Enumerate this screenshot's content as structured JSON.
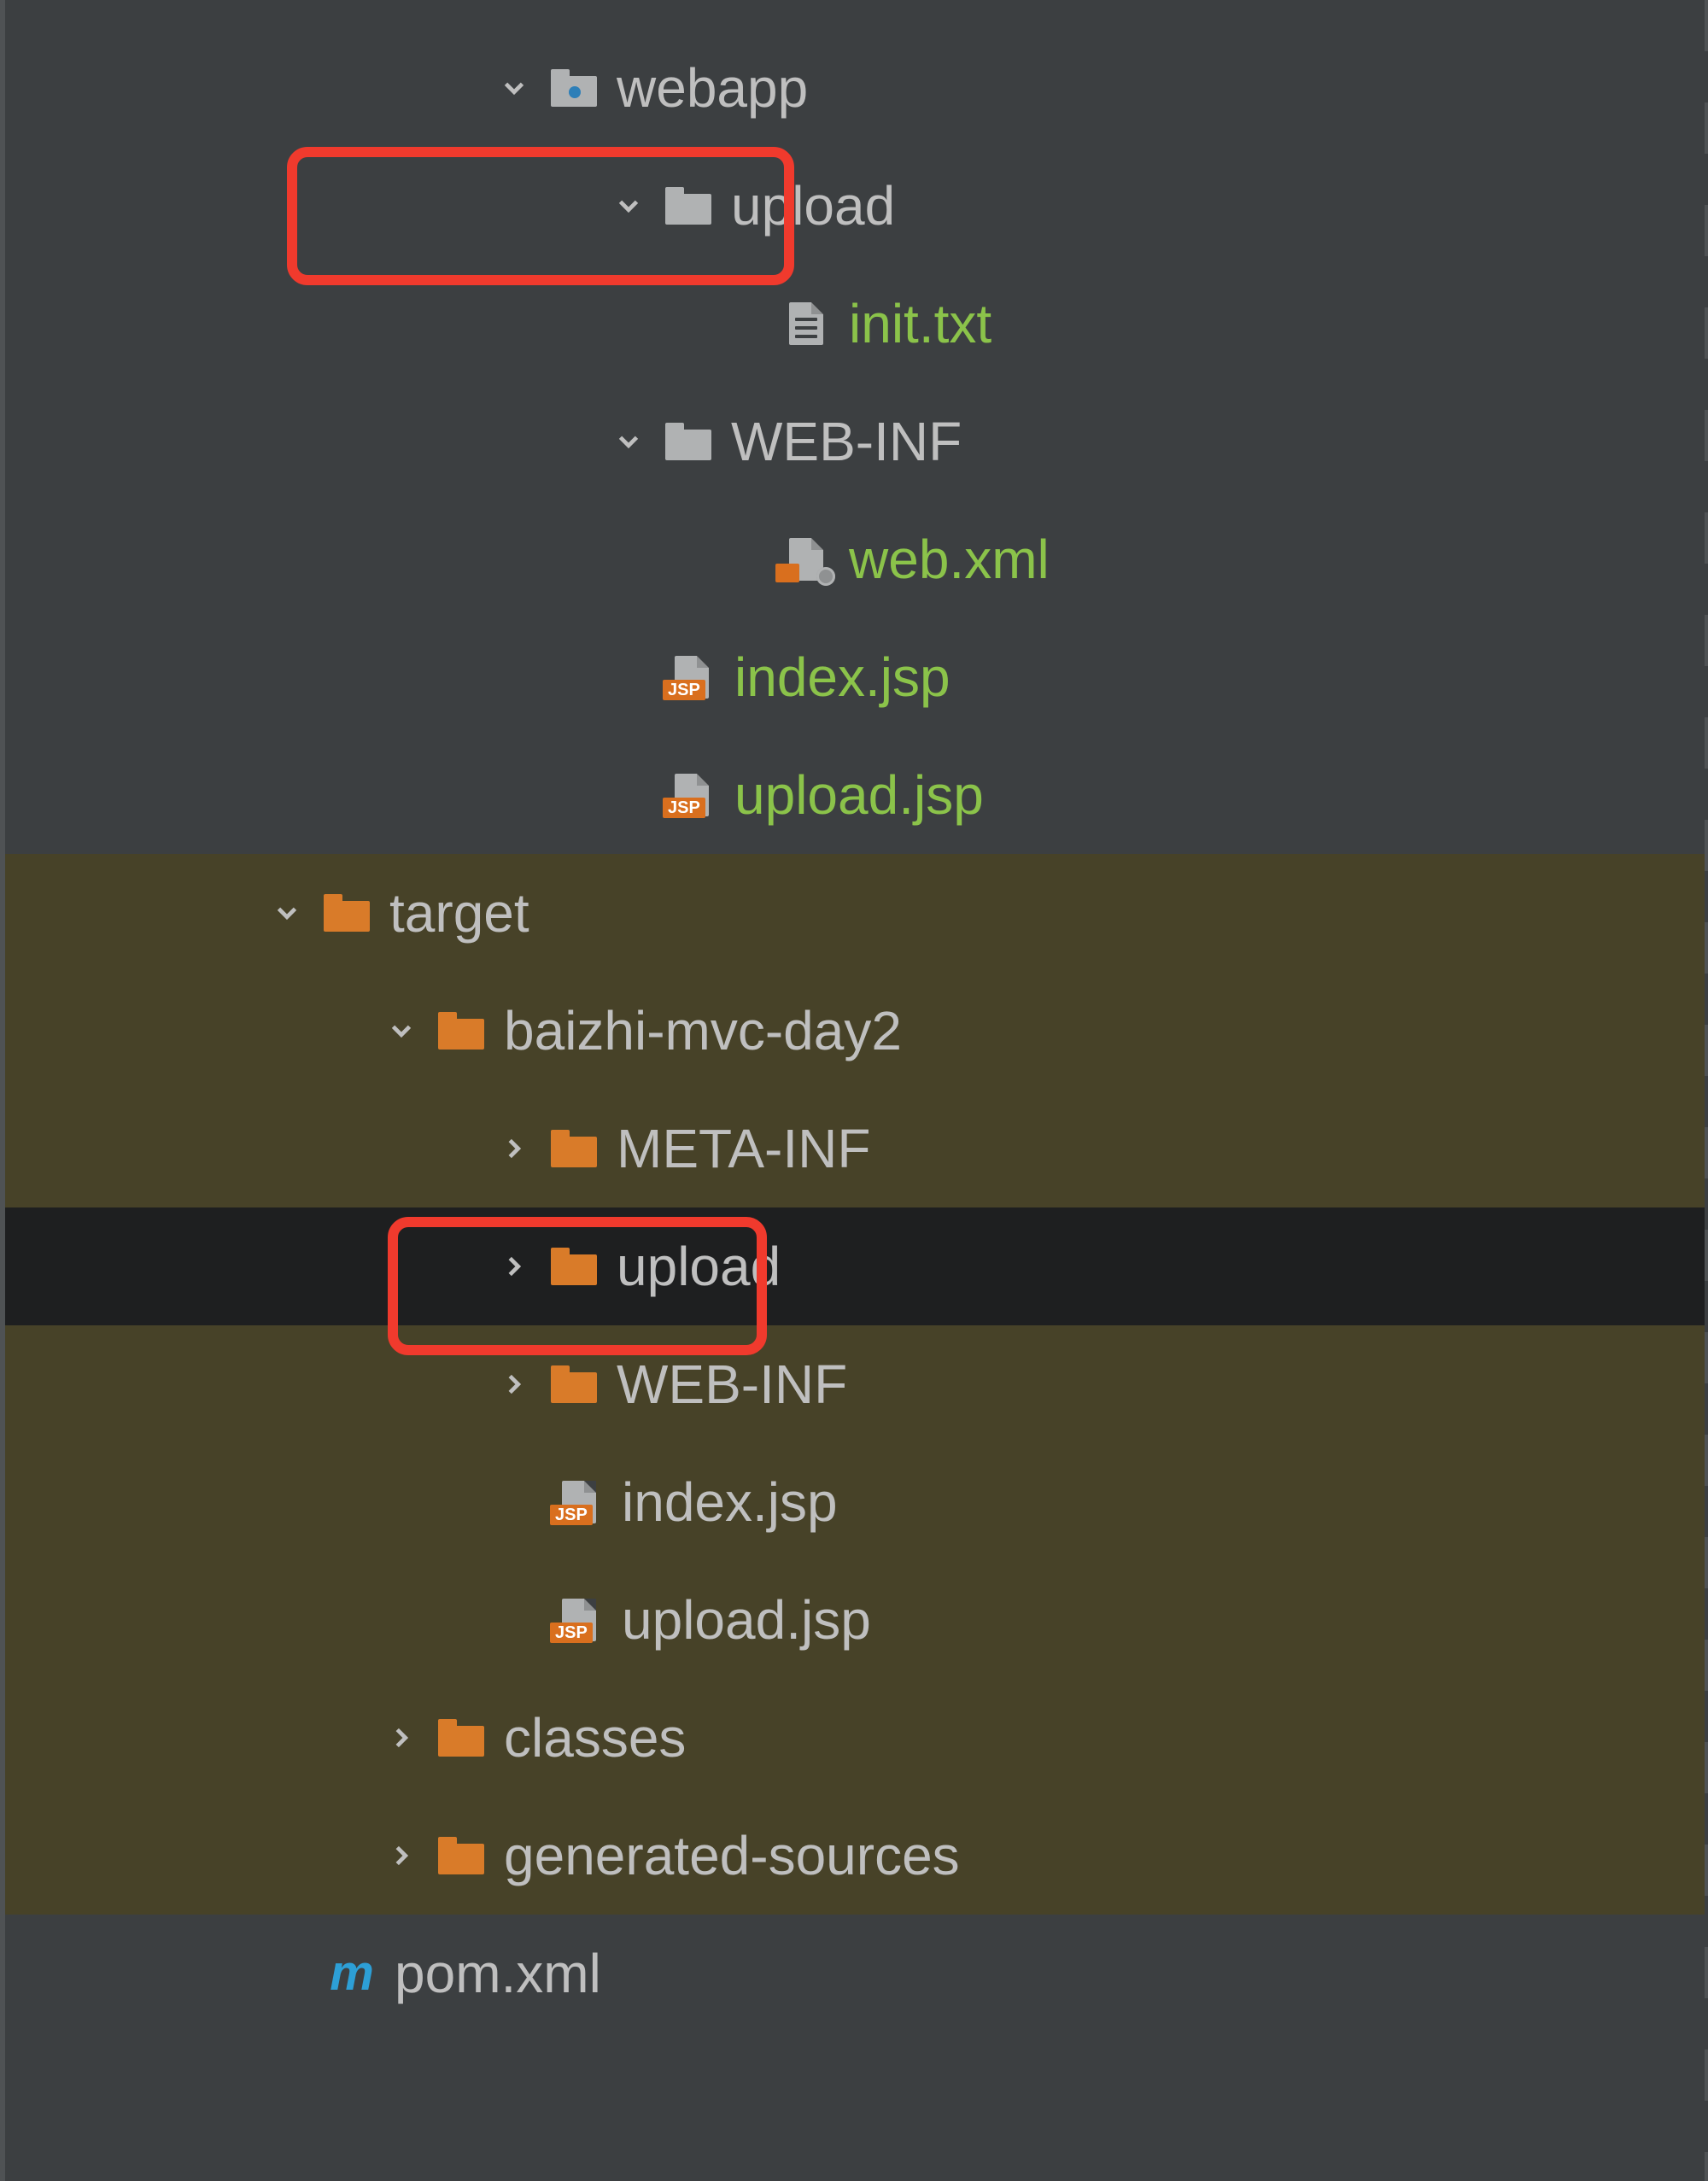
{
  "tree": {
    "webapp": {
      "label": "webapp"
    },
    "upload1": {
      "label": "upload"
    },
    "init_txt": {
      "label": "init.txt"
    },
    "web_inf1": {
      "label": "WEB-INF"
    },
    "web_xml": {
      "label": "web.xml"
    },
    "index_jsp1": {
      "label": "index.jsp"
    },
    "upload_jsp1": {
      "label": "upload.jsp"
    },
    "target": {
      "label": "target"
    },
    "baizhi": {
      "label": "baizhi-mvc-day2"
    },
    "meta_inf": {
      "label": "META-INF"
    },
    "upload2": {
      "label": "upload"
    },
    "web_inf2": {
      "label": "WEB-INF"
    },
    "index_jsp2": {
      "label": "index.jsp"
    },
    "upload_jsp2": {
      "label": "upload.jsp"
    },
    "classes": {
      "label": "classes"
    },
    "gen_sources": {
      "label": "generated-sources"
    },
    "pom_xml": {
      "label": "pom.xml"
    }
  },
  "jsp_badge": "JSP"
}
